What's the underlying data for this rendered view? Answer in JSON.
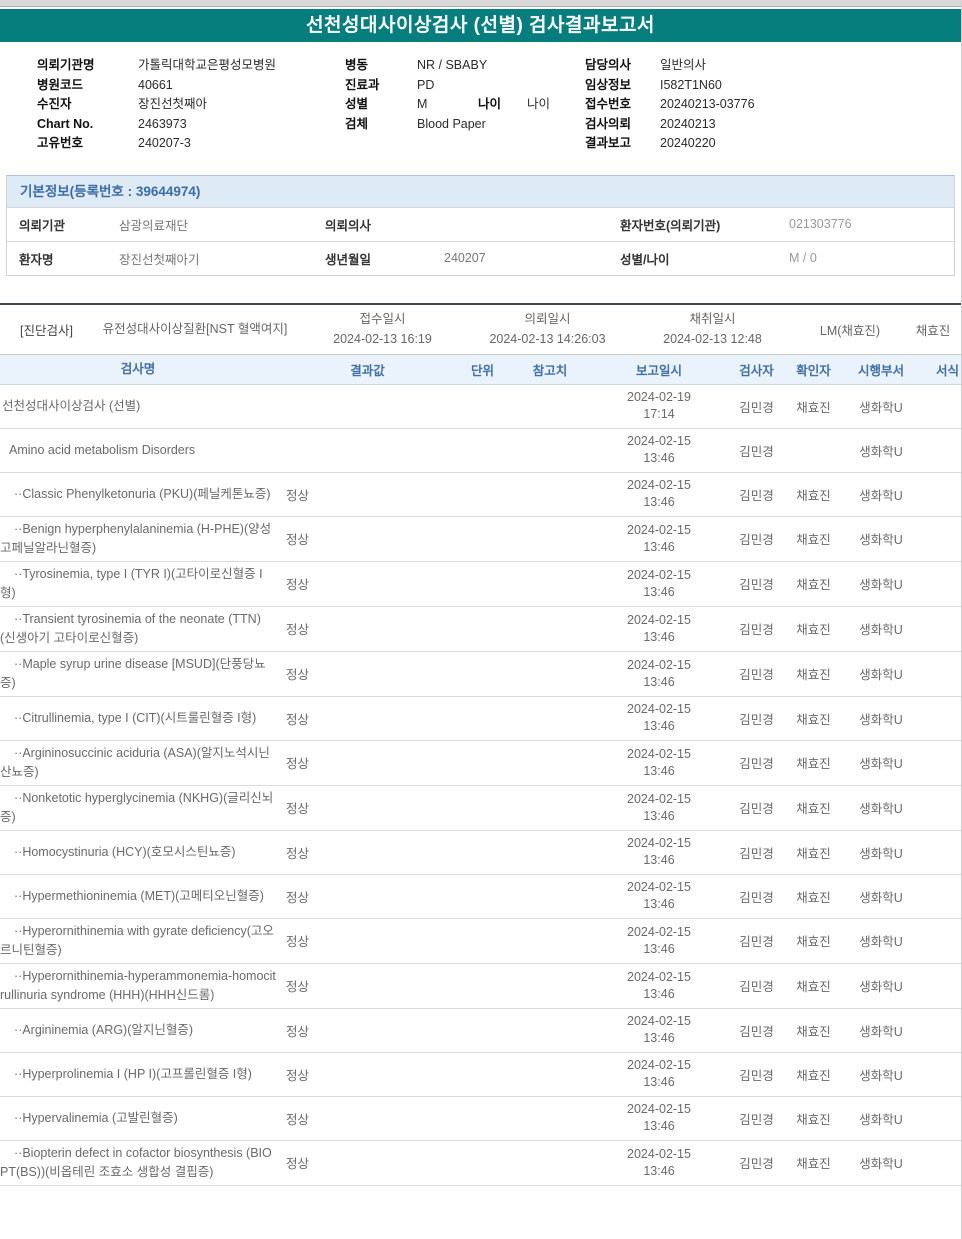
{
  "page": {
    "title": "선천성대사이상검사 (선별) 검사결과보고서"
  },
  "colors": {
    "accent_teal": "#077e7e",
    "header_blue_text": "#4270a6",
    "basic_header_bg": "#dfeaf7",
    "table_header_bg": "#eaf2fb"
  },
  "patient_info": {
    "left": [
      {
        "label": "의뢰기관명",
        "value": "가톨릭대학교은평성모병원"
      },
      {
        "label": "병원코드",
        "value": "40661"
      },
      {
        "label": "수진자",
        "value": "장진선첫째아"
      },
      {
        "label": "Chart No.",
        "value": "2463973"
      },
      {
        "label": "고유번호",
        "value": "240207-3"
      }
    ],
    "middle": [
      {
        "label": "병동",
        "value": "NR / SBABY"
      },
      {
        "label": "진료과",
        "value": "PD"
      },
      {
        "label": "성별",
        "value": "M",
        "label2": "나이",
        "value2": "나이"
      },
      {
        "label": "검체",
        "value": "Blood Paper"
      }
    ],
    "right": [
      {
        "label": "담당의사",
        "value": "일반의사"
      },
      {
        "label": "임상정보",
        "value": "I582T1N60"
      },
      {
        "label": "접수번호",
        "value": "20240213-03776"
      },
      {
        "label": "검사의뢰",
        "value": "20240213"
      },
      {
        "label": "결과보고",
        "value": "20240220"
      }
    ]
  },
  "basic_info": {
    "header": "기본정보(등록번호 : 39644974)",
    "rows": [
      {
        "l1": "의뢰기관",
        "v1": "삼광의료재단",
        "l2": "의뢰의사",
        "v2": "",
        "l3": "환자번호(의뢰기관)",
        "v3": "021303776"
      },
      {
        "l1": "환자명",
        "v1": "장진선첫째아기",
        "l2": "생년월일",
        "v2": "240207",
        "l3": "성별/나이",
        "v3": "M / 0"
      }
    ]
  },
  "diagnosis_section": {
    "tag": "[진단검사]",
    "test_group": "유전성대사이상질환[NST 혈액여지]",
    "times": [
      {
        "label": "접수일시",
        "value": "2024-02-13 16:19"
      },
      {
        "label": "의뢰일시",
        "value": "2024-02-13 14:26:03"
      },
      {
        "label": "채취일시",
        "value": "2024-02-13 12:48"
      }
    ],
    "lm": "LM(채효진)",
    "collector": "채효진"
  },
  "result_table": {
    "headers": {
      "name": "검사명",
      "result": "결과값",
      "unit": "단위",
      "ref": "참고치",
      "reported": "보고일시",
      "tester": "검사자",
      "confirmer": "확인자",
      "dept": "시행부서",
      "form": "서식"
    },
    "rows": [
      {
        "name": "선천성대사이상검사 (선별)",
        "result": "",
        "unit": "",
        "ref": "",
        "reported": "2024-02-19 17:14",
        "tester": "김민경",
        "confirmer": "채효진",
        "dept": "생화학U",
        "form": "",
        "indent": "lv0"
      },
      {
        "name": "Amino acid metabolism Disorders",
        "result": "",
        "unit": "",
        "ref": "",
        "reported": "2024-02-15 13:46",
        "tester": "김민경",
        "confirmer": "",
        "dept": "생화학U",
        "form": "",
        "indent": "lv1"
      },
      {
        "name": "··Classic Phenylketonuria (PKU)(페닐케톤뇨증)",
        "result": "정상",
        "unit": "",
        "ref": "",
        "reported": "2024-02-15 13:46",
        "tester": "김민경",
        "confirmer": "채효진",
        "dept": "생화학U",
        "form": "",
        "indent": "lv2"
      },
      {
        "name": "··Benign hyperphenylalaninemia (H-PHE)(양성 고페닐알라닌혈증)",
        "result": "정상",
        "unit": "",
        "ref": "",
        "reported": "2024-02-15 13:46",
        "tester": "김민경",
        "confirmer": "채효진",
        "dept": "생화학U",
        "form": "",
        "indent": "lv2"
      },
      {
        "name": "··Tyrosinemia, type I (TYR I)(고타이로신혈증 I형)",
        "result": "정상",
        "unit": "",
        "ref": "",
        "reported": "2024-02-15 13:46",
        "tester": "김민경",
        "confirmer": "채효진",
        "dept": "생화학U",
        "form": "",
        "indent": "lv2"
      },
      {
        "name": "··Transient tyrosinemia of the neonate (TTN)(신생아기 고타이로신혈증)",
        "result": "정상",
        "unit": "",
        "ref": "",
        "reported": "2024-02-15 13:46",
        "tester": "김민경",
        "confirmer": "채효진",
        "dept": "생화학U",
        "form": "",
        "indent": "lv2"
      },
      {
        "name": "··Maple syrup urine disease [MSUD](단풍당뇨증)",
        "result": "정상",
        "unit": "",
        "ref": "",
        "reported": "2024-02-15 13:46",
        "tester": "김민경",
        "confirmer": "채효진",
        "dept": "생화학U",
        "form": "",
        "indent": "lv2"
      },
      {
        "name": "··Citrullinemia, type I (CIT)(시트룰린혈증 I형)",
        "result": "정상",
        "unit": "",
        "ref": "",
        "reported": "2024-02-15 13:46",
        "tester": "김민경",
        "confirmer": "채효진",
        "dept": "생화학U",
        "form": "",
        "indent": "lv2"
      },
      {
        "name": "··Argininosuccinic aciduria (ASA)(알지노석시닌산뇨증)",
        "result": "정상",
        "unit": "",
        "ref": "",
        "reported": "2024-02-15 13:46",
        "tester": "김민경",
        "confirmer": "채효진",
        "dept": "생화학U",
        "form": "",
        "indent": "lv2"
      },
      {
        "name": "··Nonketotic hyperglycinemia (NKHG)(글리신뇌증)",
        "result": "정상",
        "unit": "",
        "ref": "",
        "reported": "2024-02-15 13:46",
        "tester": "김민경",
        "confirmer": "채효진",
        "dept": "생화학U",
        "form": "",
        "indent": "lv2"
      },
      {
        "name": "··Homocystinuria (HCY)(호모시스틴뇨증)",
        "result": "정상",
        "unit": "",
        "ref": "",
        "reported": "2024-02-15 13:46",
        "tester": "김민경",
        "confirmer": "채효진",
        "dept": "생화학U",
        "form": "",
        "indent": "lv2"
      },
      {
        "name": "··Hypermethioninemia (MET)(고메티오닌혈증)",
        "result": "정상",
        "unit": "",
        "ref": "",
        "reported": "2024-02-15 13:46",
        "tester": "김민경",
        "confirmer": "채효진",
        "dept": "생화학U",
        "form": "",
        "indent": "lv2"
      },
      {
        "name": "··Hyperornithinemia with gyrate deficiency(고오르니틴혈증)",
        "result": "정상",
        "unit": "",
        "ref": "",
        "reported": "2024-02-15 13:46",
        "tester": "김민경",
        "confirmer": "채효진",
        "dept": "생화학U",
        "form": "",
        "indent": "lv2"
      },
      {
        "name": "··Hyperornithinemia-hyperammonemia-homocitrullinuria syndrome (HHH)(HHH신드롬)",
        "result": "정상",
        "unit": "",
        "ref": "",
        "reported": "2024-02-15 13:46",
        "tester": "김민경",
        "confirmer": "채효진",
        "dept": "생화학U",
        "form": "",
        "indent": "lv2"
      },
      {
        "name": "··Argininemia (ARG)(알지닌혈증)",
        "result": "정상",
        "unit": "",
        "ref": "",
        "reported": "2024-02-15 13:46",
        "tester": "김민경",
        "confirmer": "채효진",
        "dept": "생화학U",
        "form": "",
        "indent": "lv2"
      },
      {
        "name": "··Hyperprolinemia I (HP I)(고프롤린혈증 I형)",
        "result": "정상",
        "unit": "",
        "ref": "",
        "reported": "2024-02-15 13:46",
        "tester": "김민경",
        "confirmer": "채효진",
        "dept": "생화학U",
        "form": "",
        "indent": "lv2"
      },
      {
        "name": "··Hypervalinemia (고발린혈증)",
        "result": "정상",
        "unit": "",
        "ref": "",
        "reported": "2024-02-15 13:46",
        "tester": "김민경",
        "confirmer": "채효진",
        "dept": "생화학U",
        "form": "",
        "indent": "lv2"
      },
      {
        "name": "··Biopterin defect in cofactor biosynthesis (BIOPT(BS))(비옵테린 조효소 생합성 결핍증)",
        "result": "정상",
        "unit": "",
        "ref": "",
        "reported": "2024-02-15 13:46",
        "tester": "김민경",
        "confirmer": "채효진",
        "dept": "생화학U",
        "form": "",
        "indent": "lv2"
      }
    ]
  }
}
